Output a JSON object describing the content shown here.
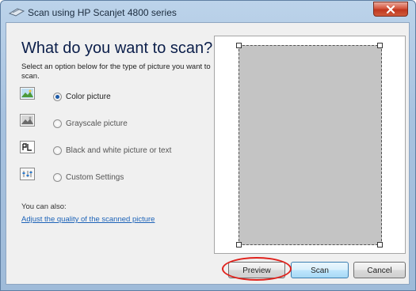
{
  "window": {
    "title": "Scan using HP Scanjet 4800 series",
    "close_icon": "close-icon"
  },
  "main": {
    "heading": "What do you want to scan?",
    "instruction": "Select an option below for the type of picture you want to scan.",
    "options": [
      {
        "label": "Color picture",
        "icon": "color-picture-icon",
        "selected": true
      },
      {
        "label": "Grayscale picture",
        "icon": "grayscale-picture-icon",
        "selected": false
      },
      {
        "label": "Black and white picture or text",
        "icon": "black-white-text-icon",
        "selected": false
      },
      {
        "label": "Custom Settings",
        "icon": "custom-settings-icon",
        "selected": false
      }
    ],
    "also_label": "You can also:",
    "adjust_link": "Adjust the quality of the scanned picture"
  },
  "buttons": {
    "preview": "Preview",
    "scan": "Scan",
    "cancel": "Cancel"
  },
  "colors": {
    "title_bar": "#a7c2df",
    "close_button": "#c0371f",
    "link": "#1d63b8",
    "highlight_ring": "#e0221c",
    "scan_area": "#c4c4c4"
  }
}
